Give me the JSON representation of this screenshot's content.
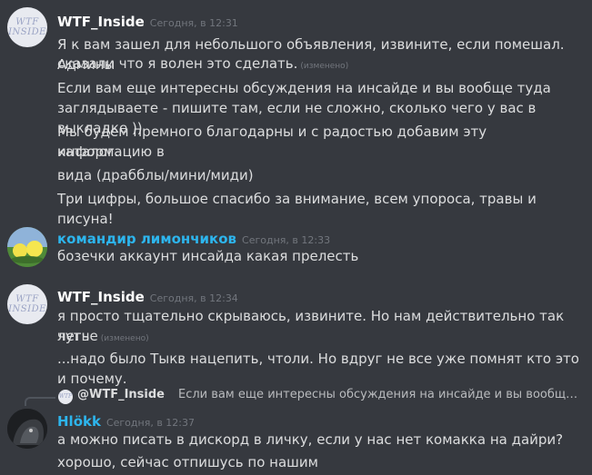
{
  "messages": [
    {
      "author": "WTF_Inside",
      "avatar_text": "WTF\nINSIDE",
      "timestamp": "Сегодня, в 12:31",
      "lines": [
        {
          "text": "Я к вам зашел для небольшого объявления, извините, если помешал. Админы"
        },
        {
          "text": "сказали что я волен это сделать.",
          "edited": "(изменено)"
        },
        {
          "text": "Если вам еще интересны обсуждения на инсайде и вы вообще туда"
        },
        {
          "text": "заглядываете - пишите там, если не сложно, сколько чего у вас в выкладке ))"
        },
        {
          "text": "Мы будем премного благодарны и с радостью добавим эту информацию в"
        },
        {
          "text": "каталог."
        },
        {
          "text": "вида (драбблы/мини/миди)"
        },
        {
          "text": "Три цифры, большое спасибо за внимание, всем упороса, травы и писуна!"
        }
      ]
    },
    {
      "author": "командир лимончиков",
      "timestamp": "Сегодня, в 12:33",
      "lines": [
        {
          "text": "бозечки аккаунт инсайда какая прелесть"
        }
      ]
    },
    {
      "author": "WTF_Inside",
      "avatar_text": "WTF\nINSIDE",
      "timestamp": "Сегодня, в 12:34",
      "lines": [
        {
          "text": "я просто тщательно скрываюсь, извините. Но нам действительно так чуть"
        },
        {
          "text": "легче",
          "edited": "(изменено)"
        },
        {
          "text": "...надо было Тыкв нацепить, чтоли. Но вдруг не все уже помнят кто это и почему."
        }
      ]
    },
    {
      "reply_to": {
        "author": "@WTF_Inside",
        "text": "Если вам еще интересны обсуждения на инсайде и вы вообще туда загля..."
      },
      "author": "Hlökk",
      "timestamp": "Сегодня, в 12:37",
      "lines": [
        {
          "text": "а можно писать в дискорд в личку, если у нас нет комакка на дайри?"
        },
        {
          "text": "хорошо, сейчас отпишусь по нашим"
        }
      ]
    }
  ]
}
